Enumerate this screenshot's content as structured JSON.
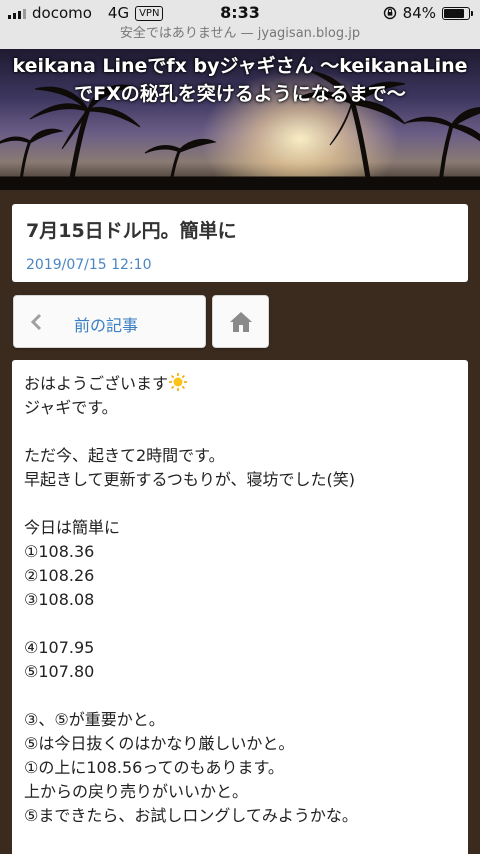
{
  "status_bar": {
    "carrier": "docomo",
    "network": "4G",
    "vpn": "VPN",
    "time": "8:33",
    "battery": "84%",
    "battery_level": 0.84
  },
  "url_bar": {
    "text": "安全ではありません — jyagisan.blog.jp"
  },
  "header": {
    "site_title_line1": "keikana Lineでfx byジャギさん 〜keikanaLine",
    "site_title_line2": "でFXの秘孔を突けるようになるまで〜"
  },
  "post": {
    "title": "7月15日ドル円。簡単に",
    "date": "2019/07/15 12:10"
  },
  "nav": {
    "prev_label": "前の記事",
    "home_icon": "home-icon"
  },
  "article": {
    "lines": [
      "おはようございます",
      "ジャギです。",
      "",
      "ただ今、起きて2時間です。",
      "早起きして更新するつもりが、寝坊でした(笑)",
      "",
      "今日は簡単に",
      "①108.36",
      "②108.26",
      "③108.08",
      "",
      "④107.95",
      "⑤107.80",
      "",
      "③、⑤が重要かと。",
      "⑤は今日抜くのはかなり厳しいかと。",
      "①の上に108.56ってのもあります。",
      "上からの戻り売りがいいかと。",
      "⑤まできたら、お試しロングしてみようかな。"
    ]
  }
}
